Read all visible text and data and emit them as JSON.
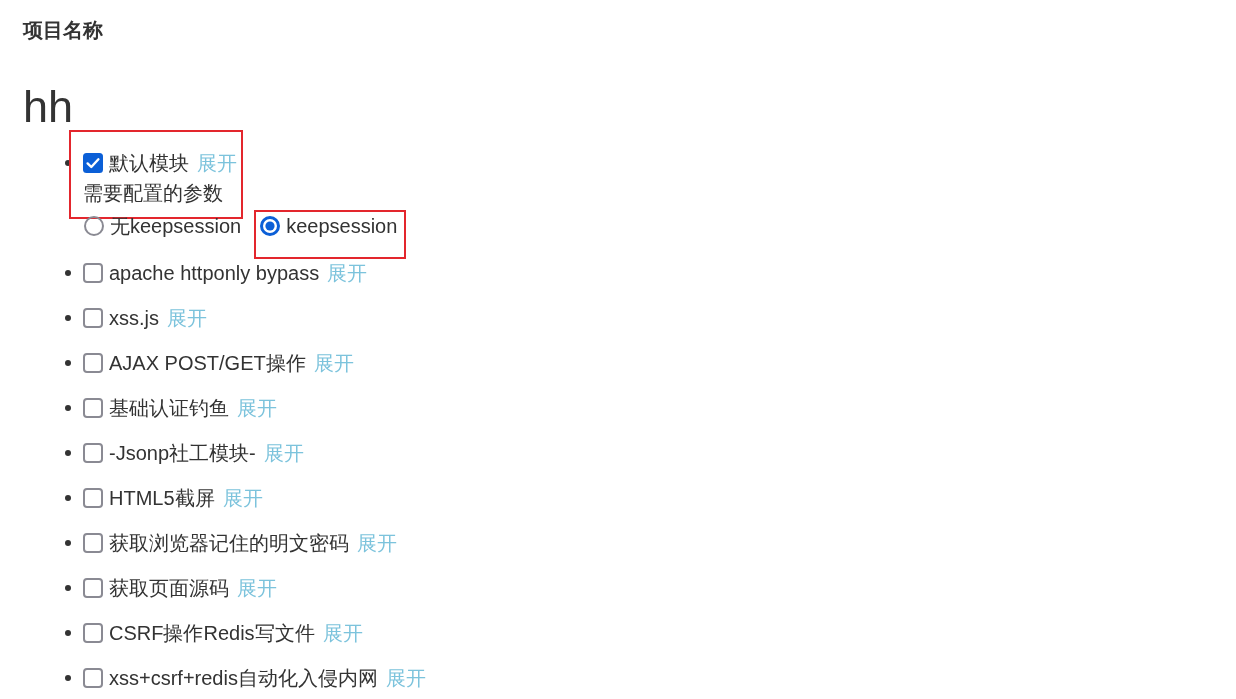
{
  "title": "项目名称",
  "project_name": "hh",
  "modules": [
    {
      "name": "默认模块",
      "checked": true,
      "toggle": "展开",
      "highlighted": true,
      "params": {
        "heading": "需要配置的参数",
        "options": [
          {
            "label": "无keepsession",
            "selected": false,
            "highlighted": false
          },
          {
            "label": "keepsession",
            "selected": true,
            "highlighted": true
          }
        ]
      }
    },
    {
      "name": "apache httponly bypass",
      "checked": false,
      "toggle": "展开",
      "highlighted": false
    },
    {
      "name": "xss.js",
      "checked": false,
      "toggle": "展开",
      "highlighted": false
    },
    {
      "name": "AJAX POST/GET操作",
      "checked": false,
      "toggle": "展开",
      "highlighted": false
    },
    {
      "name": "基础认证钓鱼",
      "checked": false,
      "toggle": "展开",
      "highlighted": false
    },
    {
      "name": "-Jsonp社工模块-",
      "checked": false,
      "toggle": "展开",
      "highlighted": false
    },
    {
      "name": "HTML5截屏",
      "checked": false,
      "toggle": "展开",
      "highlighted": false
    },
    {
      "name": "获取浏览器记住的明文密码",
      "checked": false,
      "toggle": "展开",
      "highlighted": false
    },
    {
      "name": "获取页面源码",
      "checked": false,
      "toggle": "展开",
      "highlighted": false
    },
    {
      "name": "CSRF操作Redis写文件",
      "checked": false,
      "toggle": "展开",
      "highlighted": false
    },
    {
      "name": "xss+csrf+redis自动化入侵内网",
      "checked": false,
      "toggle": "展开",
      "highlighted": false
    }
  ]
}
